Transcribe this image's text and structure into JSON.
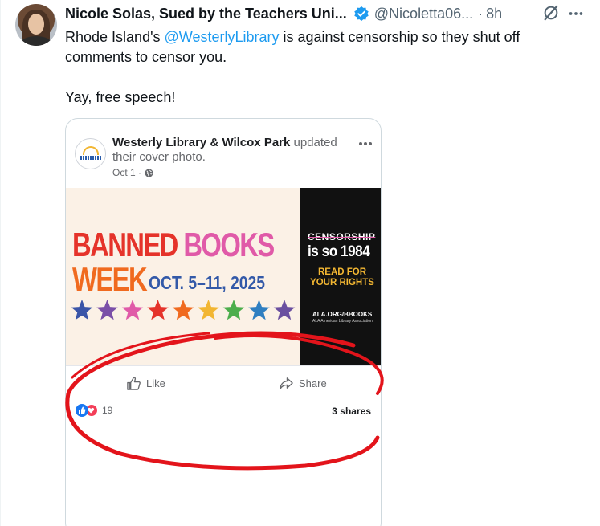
{
  "tweet": {
    "display_name": "Nicole Solas, Sued by the Teachers Uni...",
    "handle": "@Nicoletta06...",
    "time_sep": "·",
    "time": "8h",
    "text_line1_pre": "Rhode Island's ",
    "text_mention": "@WesterlyLibrary",
    "text_line1_post": " is against censorship so they shut off comments to censor you.",
    "text_line2": "Yay, free speech!",
    "icons": [
      "verified-badge-icon",
      "grok-icon",
      "more-icon"
    ]
  },
  "fb_post": {
    "page_name": "Westerly Library & Wilcox Park",
    "action": " updated their cover photo.",
    "date": "Oct 1 ·",
    "banner": {
      "banned": "BANNED",
      "books": "BOOKS",
      "week": "WEEK",
      "dates": "OCT. 5–11, 2025",
      "censorship": "CENSORSHIP",
      "is_so_1984": "is so 1984",
      "read_for": "READ FOR YOUR RIGHTS",
      "ala_url": "ALA.ORG/BBOOKS",
      "ala_name": "ALA American Library Association"
    },
    "like_label": "Like",
    "share_label": "Share",
    "reaction_count": "19",
    "shares": "3 shares"
  },
  "colors": {
    "accent": "#1d9bf0",
    "scribble": "#e3141b",
    "fb_blue": "#1877f2"
  }
}
